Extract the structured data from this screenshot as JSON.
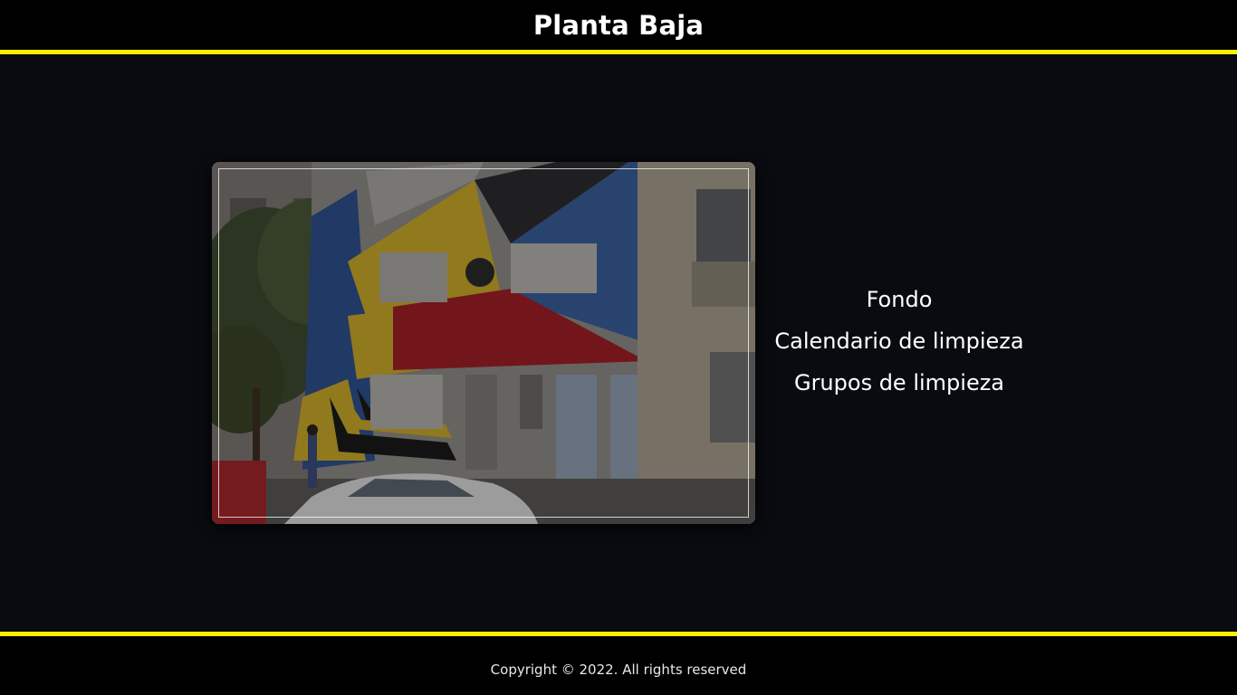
{
  "header": {
    "title": "Planta Baja"
  },
  "photo": {
    "icon": "building-facade-photo"
  },
  "nav": {
    "items": [
      {
        "label": "Fondo"
      },
      {
        "label": "Calendario de limpieza"
      },
      {
        "label": "Grupos de limpieza"
      }
    ]
  },
  "footer": {
    "copyright": "Copyright © 2022. All rights reserved"
  },
  "colors": {
    "accent": "#ffee00",
    "background": "#090b10",
    "bar": "#000000",
    "text": "#ffffff"
  }
}
